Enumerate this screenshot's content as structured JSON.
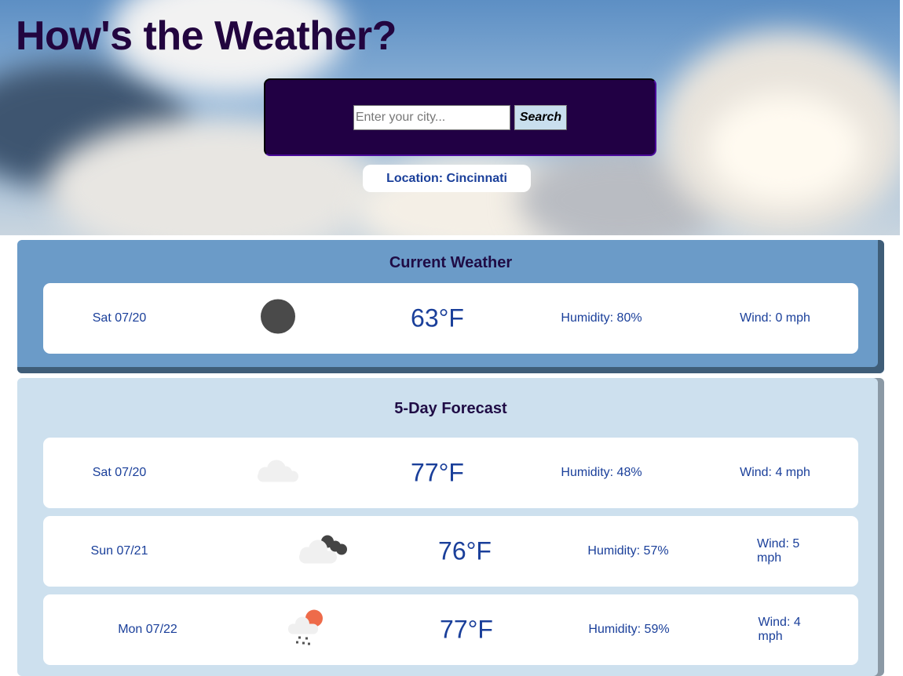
{
  "title": "How's the Weather?",
  "search": {
    "placeholder": "Enter your city...",
    "value": "",
    "button": "Search"
  },
  "location": "Location: Cincinnati",
  "current": {
    "heading": "Current Weather",
    "date": "Sat 07/20",
    "icon": "dark-circle-icon",
    "temp": "63°F",
    "humidity": "Humidity: 80%",
    "wind": "Wind: 0 mph"
  },
  "forecast": {
    "heading": "5-Day Forecast",
    "days": [
      {
        "date": "Sat 07/20",
        "icon": "cloud-icon",
        "temp": "77°F",
        "humidity": "Humidity: 48%",
        "wind": "Wind: 4 mph"
      },
      {
        "date": "Sun 07/21",
        "icon": "dark-cloud-icon",
        "temp": "76°F",
        "humidity": "Humidity: 57%",
        "wind": "Wind: 5 mph"
      },
      {
        "date": "Mon 07/22",
        "icon": "rain-sun-cloud-icon",
        "temp": "77°F",
        "humidity": "Humidity: 59%",
        "wind": "Wind: 4 mph"
      }
    ]
  }
}
